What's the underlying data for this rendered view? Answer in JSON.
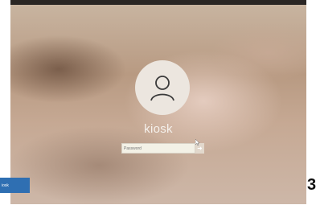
{
  "login": {
    "username": "kiosk",
    "password_placeholder": "Password"
  },
  "user_tile": {
    "label": "iosk"
  },
  "edge_text": "3",
  "colors": {
    "tile_blue": "#2f6fb2",
    "avatar_bg": "#ece6df",
    "input_bg": "#f3f1e6"
  },
  "icons": {
    "avatar": "user-silhouette-icon",
    "submit": "arrow-right-icon",
    "pointer": "mouse-cursor-icon"
  }
}
